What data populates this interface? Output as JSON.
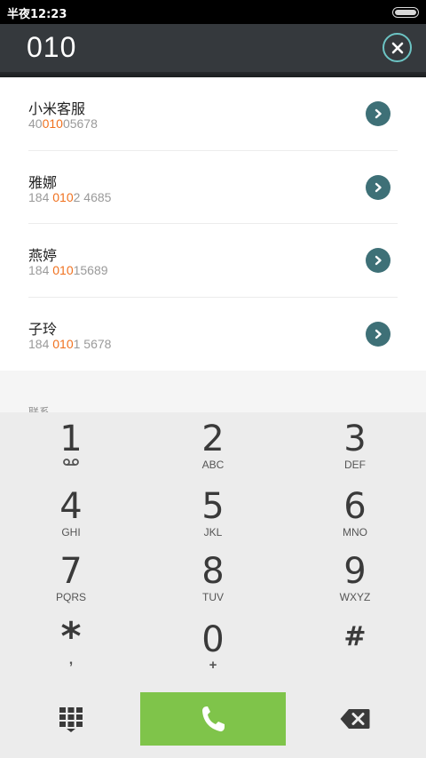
{
  "status_bar": {
    "time": "半夜12:23"
  },
  "dial_input": {
    "value": "010"
  },
  "results": [
    {
      "name": "小米客服",
      "number_pre": "40",
      "number_match": "010",
      "number_post": "05678"
    },
    {
      "name": "雅娜",
      "number_pre": "184 ",
      "number_match": "010",
      "number_post": "2 4685"
    },
    {
      "name": "燕婷",
      "number_pre": "184 ",
      "number_match": "010",
      "number_post": "15689"
    },
    {
      "name": "子玲",
      "number_pre": "184 ",
      "number_match": "010",
      "number_post": "1 5678"
    }
  ],
  "partial_section_label": "联系",
  "keypad": {
    "k1": {
      "digit": "1",
      "letters": ""
    },
    "k2": {
      "digit": "2",
      "letters": "ABC"
    },
    "k3": {
      "digit": "3",
      "letters": "DEF"
    },
    "k4": {
      "digit": "4",
      "letters": "GHI"
    },
    "k5": {
      "digit": "5",
      "letters": "JKL"
    },
    "k6": {
      "digit": "6",
      "letters": "MNO"
    },
    "k7": {
      "digit": "7",
      "letters": "PQRS"
    },
    "k8": {
      "digit": "8",
      "letters": "TUV"
    },
    "k9": {
      "digit": "9",
      "letters": "WXYZ"
    },
    "kstar": {
      "digit": "*",
      "letters": ","
    },
    "k0": {
      "digit": "0",
      "letters": "+"
    },
    "khash": {
      "digit": "#",
      "letters": ""
    }
  },
  "colors": {
    "highlight": "#f0711e",
    "call_button": "#7fc44a",
    "detail_button": "#3e7077",
    "input_bar": "#35393d"
  },
  "icons": {
    "clear": "close-icon",
    "detail": "chevron-right-icon",
    "voicemail": "voicemail-icon",
    "dialpad": "dialpad-icon",
    "call": "phone-icon",
    "backspace": "backspace-icon"
  }
}
